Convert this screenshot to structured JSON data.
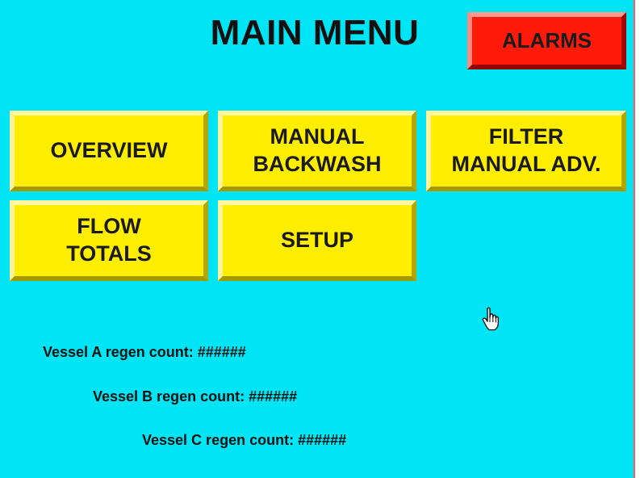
{
  "title": "MAIN MENU",
  "alarms_button": {
    "label": "ALARMS",
    "color": "#ff1a0a"
  },
  "menu_buttons": [
    {
      "label": "OVERVIEW"
    },
    {
      "label": "MANUAL\nBACKWASH"
    },
    {
      "label": "FILTER\nMANUAL ADV."
    },
    {
      "label": "FLOW\nTOTALS"
    },
    {
      "label": "SETUP"
    }
  ],
  "regen_counts": [
    {
      "label": "Vessel A regen count:",
      "value": "######"
    },
    {
      "label": "Vessel B regen count:",
      "value": "######"
    },
    {
      "label": "Vessel C regen count:",
      "value": "######"
    }
  ],
  "colors": {
    "background": "#00e5f6",
    "button": "#ffee00",
    "alarm": "#ff1a0a"
  },
  "cursor_icon": "hand-pointer-icon"
}
